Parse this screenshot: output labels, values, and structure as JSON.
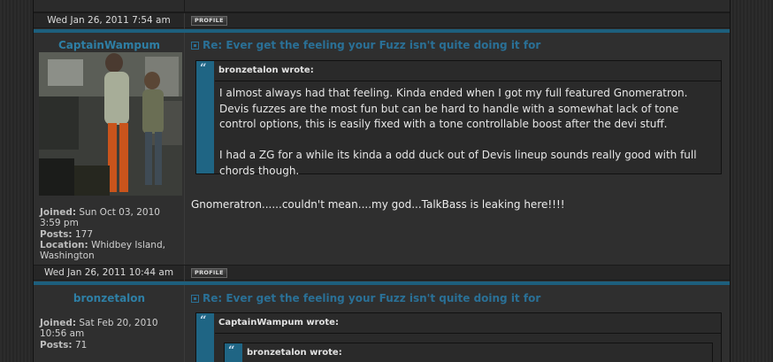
{
  "posts": [
    {
      "date": "Wed Jan 26, 2011 7:54 am",
      "profile_label": "PROFILE",
      "username": "CaptainWampum",
      "subject": "Re: Ever get the feeling your Fuzz isn't quite doing it for",
      "joined_label": "Joined:",
      "joined": "Sun Oct 03, 2010",
      "joined_time": "3:59 pm",
      "posts_label": "Posts:",
      "posts": "177",
      "location_label": "Location:",
      "location": "Whidbey Island,",
      "location2": "Washington",
      "quote_author": "bronzetalon wrote:",
      "quote_p1": "I almost always had that feeling. Kinda ended when I got my full featured Gnomeratron. Devis fuzzes are the most fun but can be hard to handle with a somewhat lack of tone control options, this is easily fixed with a tone controllable boost after the devi stuff.",
      "quote_p2": "I had a ZG for a while its kinda a odd duck out of Devis lineup sounds really good with full chords though.",
      "message": "Gnomeratron......couldn't mean....my god...TalkBass is leaking here!!!!"
    },
    {
      "date": "Wed Jan 26, 2011 10:44 am",
      "profile_label": "PROFILE",
      "username": "bronzetalon",
      "subject": "Re: Ever get the feeling your Fuzz isn't quite doing it for",
      "joined_label": "Joined:",
      "joined": "Sat Feb 20, 2010",
      "joined_time": "10:56 am",
      "posts_label": "Posts:",
      "posts": "71",
      "quote_author": "CaptainWampum wrote:",
      "nested_quote_author": "bronzetalon wrote:"
    }
  ],
  "colors": {
    "accent": "#1d5f7d",
    "username": "#2e7fa5",
    "subject": "#2a7096"
  },
  "icons": {
    "post": "post-icon",
    "quote": "quote-icon"
  }
}
